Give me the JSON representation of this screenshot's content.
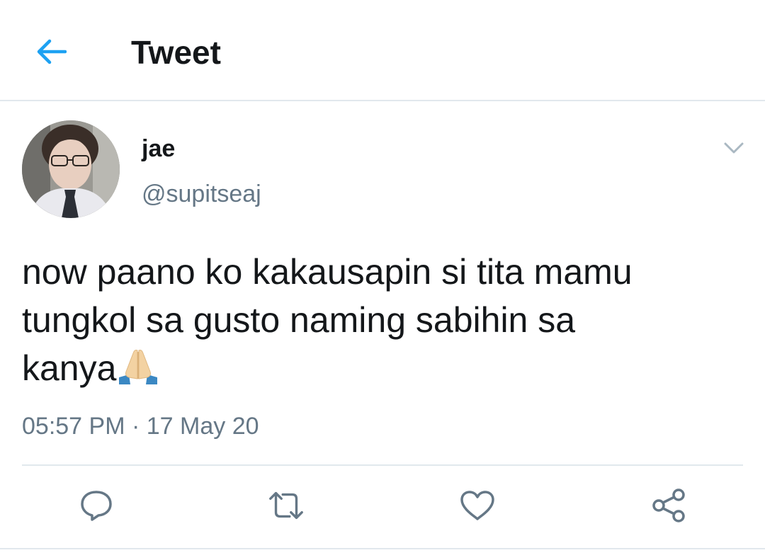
{
  "header": {
    "title": "Tweet",
    "back_icon": "arrow-left-icon"
  },
  "tweet": {
    "author": {
      "display_name": "jae",
      "handle": "@supitseaj"
    },
    "text_lines": [
      "now paano ko kakausapin si tita mamu",
      "tungkol sa gusto naming sabihin sa",
      "kanya"
    ],
    "emoji": "folded-hands-emoji",
    "time": "05:57 PM",
    "separator": "·",
    "date": "17 May 20"
  },
  "actions": [
    {
      "name": "reply",
      "icon": "speech-bubble-icon"
    },
    {
      "name": "retweet",
      "icon": "retweet-icon"
    },
    {
      "name": "like",
      "icon": "heart-icon"
    },
    {
      "name": "share",
      "icon": "share-icon"
    }
  ],
  "colors": {
    "accent": "#1da1f2",
    "text_primary": "#14171a",
    "text_secondary": "#657786",
    "divider": "#e1e8ed"
  }
}
